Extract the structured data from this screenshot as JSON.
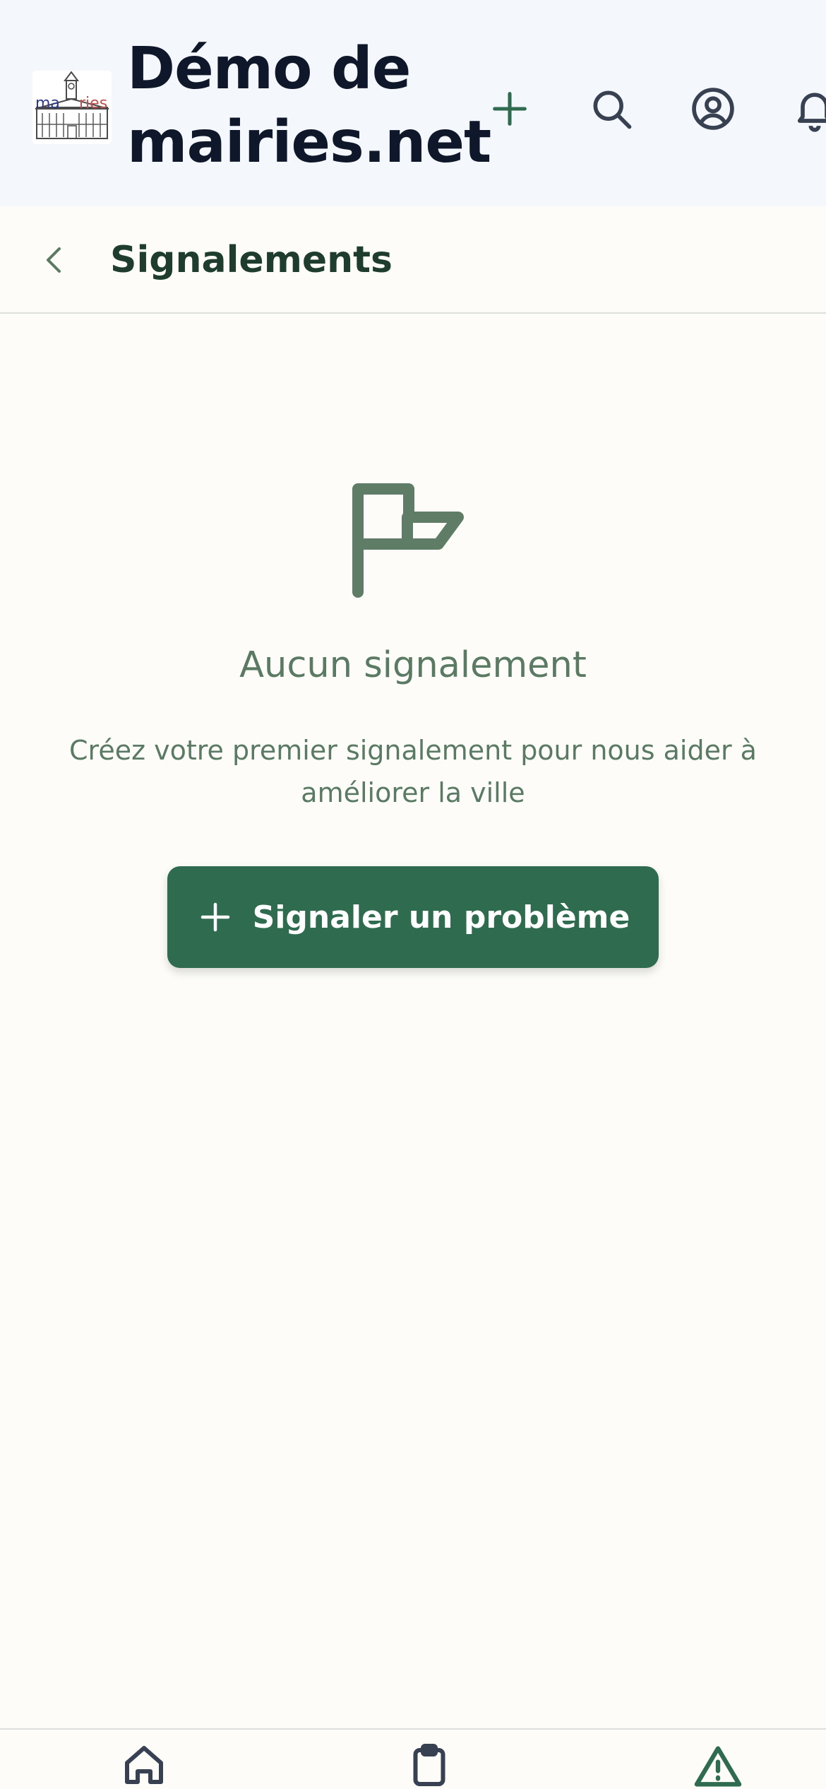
{
  "header": {
    "title": "Démo de mairies.net",
    "logo_text": "mairies",
    "icons": {
      "add": "plus-icon",
      "search": "search-icon",
      "account": "user-circle-icon",
      "notifications": "bell-icon"
    }
  },
  "subheader": {
    "back_icon": "chevron-left-icon",
    "title": "Signalements"
  },
  "empty_state": {
    "icon": "flag-icon",
    "heading": "Aucun signalement",
    "description": "Créez votre premier signalement pour nous aider à améliorer la ville",
    "button_label": "Signaler un problème",
    "button_icon": "plus-icon"
  },
  "bottom_nav": {
    "items": [
      {
        "icon": "home-icon"
      },
      {
        "icon": "clipboard-icon"
      },
      {
        "icon": "alert-triangle-icon"
      }
    ]
  },
  "colors": {
    "primary": "#2f6b4f",
    "muted_green": "#5a7a63",
    "header_bg": "#f4f7fb",
    "page_bg": "#fdfcf8",
    "title_text": "#0f172a"
  }
}
